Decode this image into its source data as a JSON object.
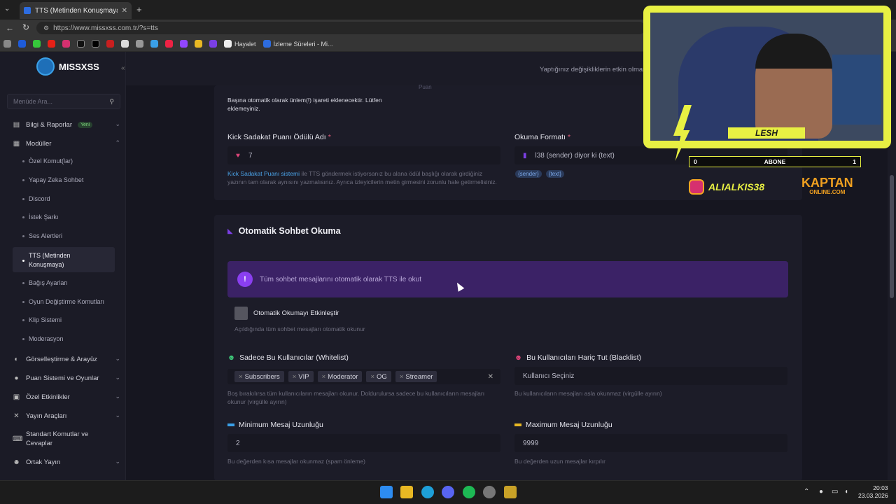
{
  "browser": {
    "tab_title": "TTS (Metinden Konuşmaya) - Mi...",
    "url": "https://www.missxss.com.tr/?s=tts",
    "bookmarks": [
      "Hayalet",
      "İzleme Süreleri - Mi..."
    ]
  },
  "brand": {
    "name": "MISSXSS"
  },
  "search": {
    "placeholder": "Menüde Ara..."
  },
  "topbar": {
    "notice": "Yaptığınız değişikliklerin etkin olmas"
  },
  "sidebar": {
    "items": [
      {
        "label": "Bilgi & Raporlar",
        "badge": "Yeni"
      },
      {
        "label": "Modüller"
      },
      {
        "label": "Görselleştirme & Arayüz"
      },
      {
        "label": "Puan Sistemi ve Oyunlar"
      },
      {
        "label": "Özel Etkinlikler"
      },
      {
        "label": "Yayın Araçları"
      },
      {
        "label": "Standart Komutlar ve Cevaplar"
      },
      {
        "label": "Ortak Yayın"
      }
    ],
    "subitems": [
      "Özel Komut(lar)",
      "Yapay Zeka Sohbet",
      "Discord",
      "İstek Şarkı",
      "Ses Alertleri",
      "TTS (Metinden Konuşmaya)",
      "Bağış Ayarları",
      "Oyun Değiştirme Komutları",
      "Klip Sistemi",
      "Moderasyon"
    ]
  },
  "top_section": {
    "partial_right": "Puan",
    "warning": "Başına otomatik olarak ünlem(!) işareti eklenecektir. Lütfen eklemeyiniz.",
    "reward_label": "Kick Sadakat Puanı Ödülü Adı",
    "reward_value": "7",
    "format_label": "Okuma Formatı",
    "format_value": "l38 (sender) diyor ki (text)",
    "chips": [
      "{sender}",
      "{text}"
    ],
    "help_link": "Kick Sadakat Puanı sistemi",
    "help_text": " ile TTS göndermek istiyorsanız bu alana ödül başlığı olarak girdiğiniz yazının tam olarak aynısını yazmalısınız. Ayrıca izleyicilerin metin girmesini zorunlu hale getirmelisiniz."
  },
  "auto_section": {
    "title": "Otomatik Sohbet Okuma",
    "banner": "Tüm sohbet mesajlarını otomatik olarak TTS ile okut",
    "toggle_label": "Otomatik Okumayı Etkinleştir",
    "toggle_help": "Açıldığında tüm sohbet mesajları otomatik okunur",
    "whitelist_label": "Sadece Bu Kullanıcılar (Whitelist)",
    "whitelist_tags": [
      "Subscribers",
      "VIP",
      "Moderator",
      "OG",
      "Streamer"
    ],
    "whitelist_help": "Boş bırakılırsa tüm kullanıcıların mesajları okunur. Doldurulursa sadece bu kullanıcıların mesajları okunur (virgülle ayırın)",
    "blacklist_label": "Bu Kullanıcıları Hariç Tut (Blacklist)",
    "blacklist_placeholder": "Kullanıcı Seçiniz",
    "blacklist_help": "Bu kullanıcıların mesajları asla okunmaz (virgülle ayırın)",
    "min_label": "Minimum Mesaj Uzunluğu",
    "min_value": "2",
    "min_help": "Bu değerden kısa mesajlar okunmaz (spam önleme)",
    "max_label": "Maximum Mesaj Uzunluğu",
    "max_value": "9999",
    "max_help": "Bu değerden uzun mesajlar kırpılır"
  },
  "overlay": {
    "name": "LESH",
    "sub_left": "0",
    "sub_mid": "ABONE",
    "sub_right": "1",
    "instagram": "ALIALKIS38",
    "sponsor_line1": "KAPTAN",
    "sponsor_line2": "ONLINE.COM"
  },
  "taskbar": {
    "time": "20:03",
    "date": "23.03.2026"
  },
  "colors": {
    "accent": "#7b3fe4",
    "banner": "#3b2266",
    "overlay": "#e8f043"
  }
}
